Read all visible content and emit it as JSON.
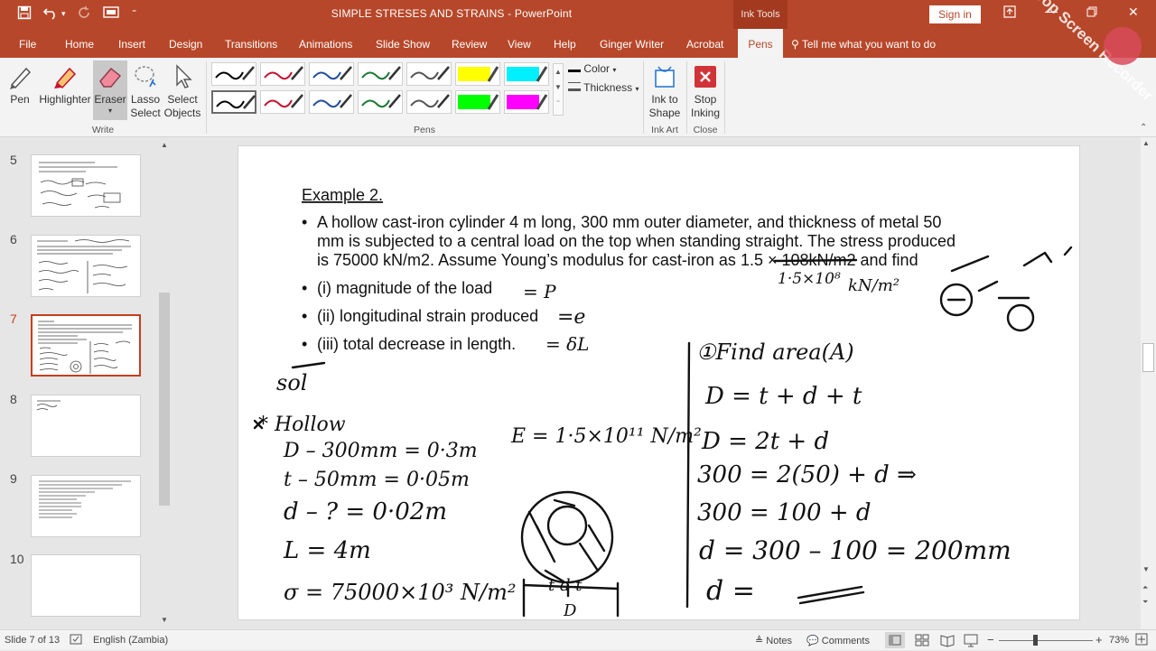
{
  "window": {
    "title": "SIMPLE STRESES AND STRAINS  -  PowerPoint",
    "context_tab": "Ink Tools",
    "sign_in": "Sign in",
    "watermark": "iTop Screen Recorder"
  },
  "tabs": [
    "File",
    "Home",
    "Insert",
    "Design",
    "Transitions",
    "Animations",
    "Slide Show",
    "Review",
    "View",
    "Help",
    "Ginger Writer",
    "Acrobat"
  ],
  "active_tab": "Pens",
  "tell_me": "Tell me what you want to do",
  "ribbon": {
    "pen": "Pen",
    "highlighter": "Highlighter",
    "eraser": "Eraser",
    "lasso_1": "Lasso",
    "lasso_2": "Select",
    "select_1": "Select",
    "select_2": "Objects",
    "write_group": "Write",
    "pens_group": "Pens",
    "color": "Color",
    "thickness": "Thickness",
    "ink_shape_1": "Ink to",
    "ink_shape_2": "Shape",
    "ink_art_group": "Ink Art",
    "stop_1": "Stop",
    "stop_2": "Inking",
    "close_group": "Close",
    "pen_colors": [
      "#000000",
      "#c8102e",
      "#1f4e9c",
      "#1a7a32",
      "#555555",
      "#ffff00",
      "#00f0ff",
      "#000000",
      "#c8102e",
      "#1f4e9c",
      "#1a7a32",
      "#555555",
      "#00ff00",
      "#ff00ff"
    ]
  },
  "thumbnails": {
    "numbers": [
      "5",
      "6",
      "7",
      "8",
      "9",
      "10"
    ],
    "selected": "7"
  },
  "slide": {
    "heading": "Example 2.",
    "bullet1_line1": "A hollow cast-iron cylinder 4 m long, 300 mm outer diameter, and thickness of metal 50",
    "bullet1_line2": "mm is subjected to a central load on the top when standing straight. The stress produced",
    "bullet1_line3a": "is 75000 kN/m2. Assume Young’s modulus for cast-iron as",
    "bullet1_line3b": "1.5 × 108",
    "bullet1_line3c": "kN/m2 and find",
    "bullet2": "(i) magnitude of the load",
    "bullet3": "(ii) longitudinal strain produced",
    "bullet4": "(iii) total decrease in length."
  },
  "status": {
    "slide_of": "Slide 7 of 13",
    "language": "English (Zambia)",
    "notes": "Notes",
    "comments": "Comments",
    "zoom": "73%"
  }
}
